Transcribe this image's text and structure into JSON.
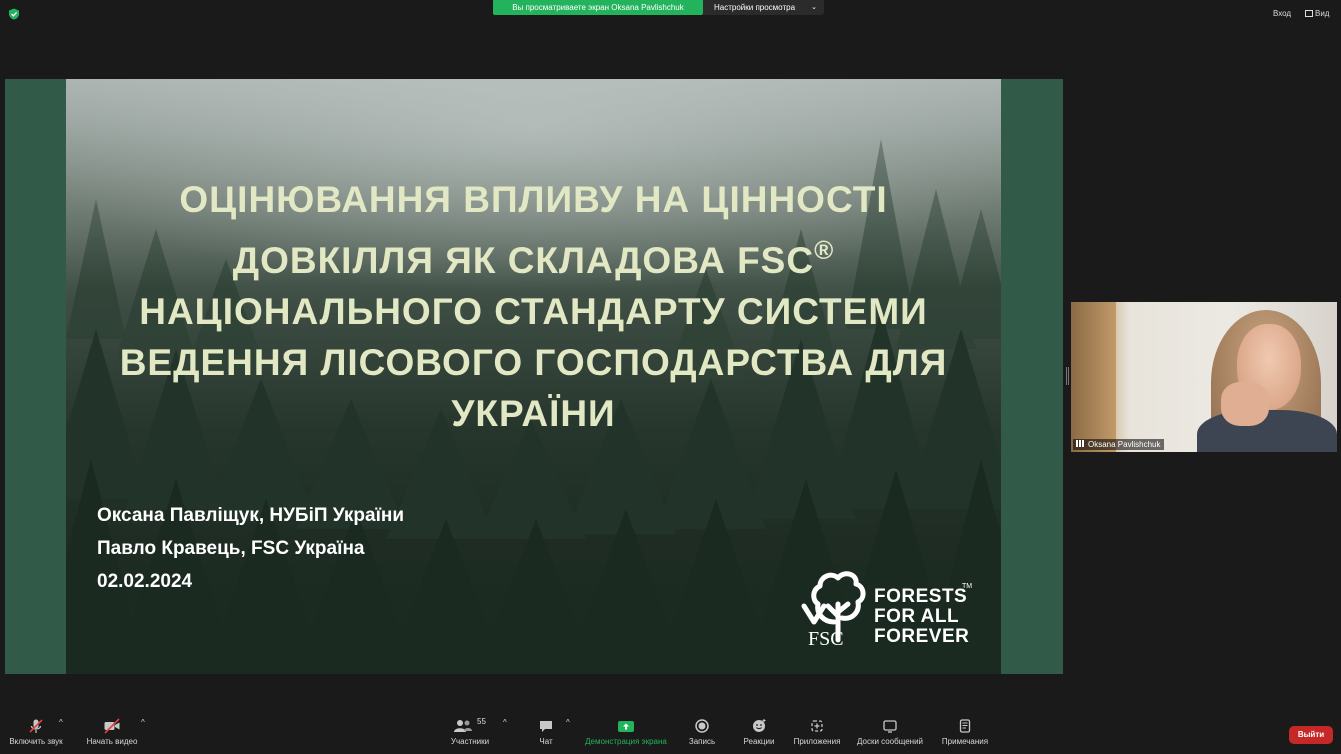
{
  "top_bar": {
    "share_notice": "Вы просматриваете экран Oksana Pavlishchuk",
    "view_options": "Настройки просмотра",
    "enter": "Вход",
    "view": "Вид"
  },
  "slide": {
    "title_lines": [
      "ОЦІНЮВАННЯ ВПЛИВУ НА ЦІННОСТІ",
      "ДОВКІЛЛЯ ЯК СКЛАДОВА FSC",
      "НАЦІОНАЛЬНОГО СТАНДАРТУ СИСТЕМИ",
      "ВЕДЕННЯ ЛІСОВОГО ГОСПОДАРСТВА ДЛЯ",
      "УКРАЇНИ"
    ],
    "registered_mark": "®",
    "authors": [
      "Оксана Павліщук, НУБіП України",
      "Павло Кравець, FSC Україна",
      "02.02.2024"
    ],
    "logo_lines": [
      "FORESTS",
      "FOR ALL",
      "FOREVER"
    ],
    "logo_tm": "TM",
    "logo_word": "FSC"
  },
  "video": {
    "participant_name": "Oksana Pavlishchuk"
  },
  "toolbar": {
    "mute": "Включить звук",
    "start_video": "Начать видео",
    "participants": "Участники",
    "participants_count": "55",
    "chat": "Чат",
    "share_screen": "Демонстрация экрана",
    "record": "Запись",
    "reactions": "Реакции",
    "apps": "Приложения",
    "whiteboards": "Доски сообщений",
    "notes": "Примечания",
    "leave": "Выйти"
  },
  "colors": {
    "share_green": "#23b35c",
    "leave_red": "#c62828",
    "slide_border": "#325a48",
    "title_color": "#e2e8c4"
  }
}
